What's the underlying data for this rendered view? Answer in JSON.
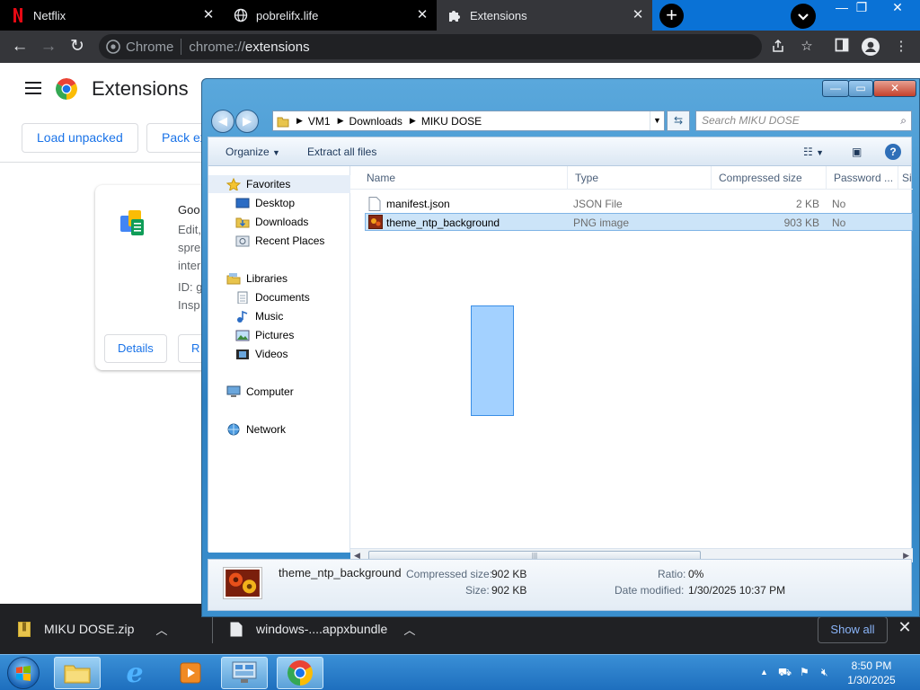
{
  "browser": {
    "tabs": [
      {
        "title": "Netflix"
      },
      {
        "title": "pobrelifx.life"
      },
      {
        "title": "Extensions"
      }
    ],
    "new_tab_label": "+",
    "omnibox": {
      "site": "Chrome",
      "url_prefix": "chrome://",
      "url_path": "extensions"
    }
  },
  "extensions_page": {
    "title": "Extensions",
    "buttons": {
      "load_unpacked": "Load unpacked",
      "pack": "Pack ex"
    },
    "card": {
      "name": "Goo",
      "desc1": "Edit,",
      "desc2": "spre",
      "desc3": "inter",
      "id_line": "ID: g",
      "inspect": "Insp",
      "details_btn": "Details",
      "remove_btn": "R"
    }
  },
  "explorer": {
    "breadcrumb": [
      "VM1",
      "Downloads",
      "MIKU DOSE"
    ],
    "search_placeholder": "Search MIKU DOSE",
    "toolbar": {
      "organize": "Organize",
      "extract": "Extract all files"
    },
    "nav": {
      "favorites": "Favorites",
      "desktop": "Desktop",
      "downloads": "Downloads",
      "recent": "Recent Places",
      "libraries": "Libraries",
      "documents": "Documents",
      "music": "Music",
      "pictures": "Pictures",
      "videos": "Videos",
      "computer": "Computer",
      "network": "Network"
    },
    "columns": [
      "Name",
      "Type",
      "Compressed size",
      "Password ...",
      "Si"
    ],
    "files": [
      {
        "name": "manifest.json",
        "type": "JSON File",
        "size": "2 KB",
        "password": "No"
      },
      {
        "name": "theme_ntp_background",
        "type": "PNG image",
        "size": "903 KB",
        "password": "No"
      }
    ],
    "details": {
      "filename": "theme_ntp_background",
      "compressed_label": "Compressed size:",
      "compressed_value": "902 KB",
      "size_label": "Size:",
      "size_value": "902 KB",
      "ratio_label": "Ratio:",
      "ratio_value": "0%",
      "modified_label": "Date modified:",
      "modified_value": "1/30/2025 10:37 PM"
    }
  },
  "download_shelf": {
    "items": [
      {
        "name": "MIKU DOSE.zip"
      },
      {
        "name": "windows-....appxbundle"
      }
    ],
    "show_all": "Show all"
  },
  "taskbar": {
    "time": "8:50 PM",
    "date": "1/30/2025"
  }
}
